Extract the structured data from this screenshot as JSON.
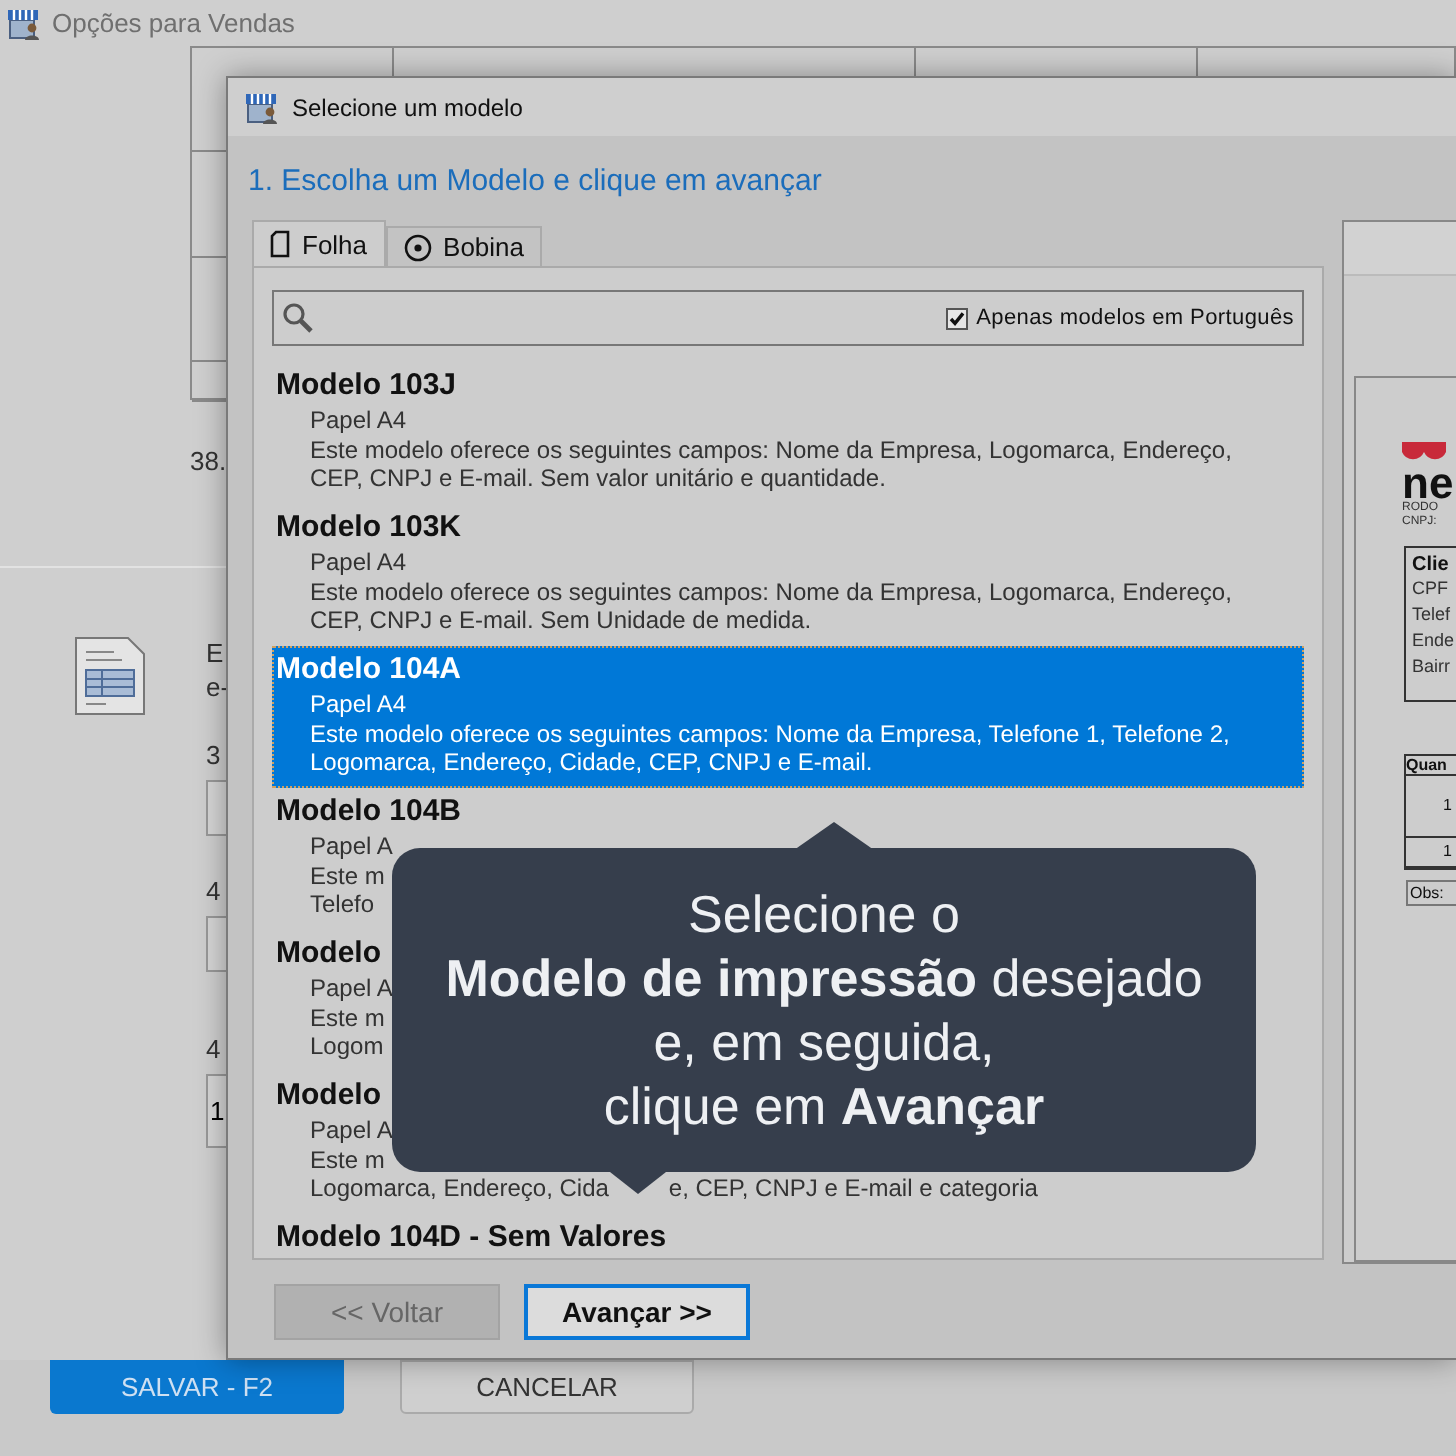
{
  "background_window": {
    "title": "Opções para Vendas",
    "total_fragment": "38.",
    "info_lines": [
      "E",
      "e-"
    ],
    "fields": [
      {
        "label": "3"
      },
      {
        "label": "4"
      },
      {
        "label": "4",
        "value": "1"
      }
    ],
    "buttons": [
      {
        "label": "SALVAR - F2",
        "kind": "primary"
      },
      {
        "label": "CANCELAR",
        "kind": "secondary"
      }
    ]
  },
  "dialog": {
    "title": "Selecione um modelo",
    "heading": "1. Escolha um Modelo e clique em avançar",
    "tabs": [
      {
        "label": "Folha",
        "kind": "sheet",
        "selected": true
      },
      {
        "label": "Bobina",
        "kind": "roll",
        "selected": false
      }
    ],
    "filter": {
      "label": "Apenas modelos em Português",
      "checked": true
    },
    "models": [
      {
        "title": "Modelo 103J",
        "lines": [
          [
            "Papel A4"
          ],
          [
            "Este modelo oferece os seguintes campos: Nome da Empresa, Logomarca, Endereço,"
          ],
          [
            "CEP, CNPJ e E-mail. Sem valor unitário e quantidade."
          ]
        ],
        "selected": false
      },
      {
        "title": "Modelo 103K",
        "lines": [
          [
            "Papel A4"
          ],
          [
            "Este modelo oferece os seguintes campos: Nome da Empresa, Logomarca, Endereço,"
          ],
          [
            "CEP, CNPJ e E-mail. Sem Unidade de medida."
          ]
        ],
        "selected": false
      },
      {
        "title": "Modelo 104A",
        "lines": [
          [
            "Papel A4"
          ],
          [
            "Este modelo oferece os seguintes campos: Nome da Empresa, Telefone 1, Telefone 2,"
          ],
          [
            "Logomarca, Endereço, Cidade, CEP, CNPJ e E-mail."
          ]
        ],
        "selected": true
      },
      {
        "title": "Modelo 104B",
        "lines": [
          [
            "Papel A"
          ],
          [
            "Este m"
          ],
          [
            "Telefo"
          ]
        ],
        "selected": false
      },
      {
        "title": "Modelo",
        "lines": [
          [
            "Papel A"
          ],
          [
            "Este m"
          ],
          [
            "Logom"
          ]
        ],
        "selected": false
      },
      {
        "title": "Modelo",
        "lines": [
          [
            "Papel A"
          ],
          [
            "Este m"
          ],
          [
            "Logomarca, Endereço, Cida",
            "e, CEP, CNPJ e E-mail e categoria"
          ]
        ],
        "selected": false
      },
      {
        "title": "Modelo 104D - Sem Valores",
        "selected": false
      }
    ],
    "buttons": [
      {
        "label": "<< Voltar",
        "disabled": true,
        "focused": false
      },
      {
        "label": "Avançar >>",
        "disabled": false,
        "focused": true
      }
    ],
    "preview": {
      "brand": "ne",
      "brand_lines": [
        "RODO",
        "CNPJ:"
      ],
      "client_heading": "Clie",
      "client_lines": [
        "CPF",
        "Telef",
        "Ende",
        "Bairr"
      ],
      "table_heading": "Quan",
      "table_cells": [
        "1",
        "1"
      ],
      "obs": "Obs:"
    }
  },
  "tooltip": {
    "lines": [
      "Selecione o",
      "**Modelo de impressão** desejado",
      "e, em seguida,",
      "clique em **Avançar**"
    ]
  }
}
